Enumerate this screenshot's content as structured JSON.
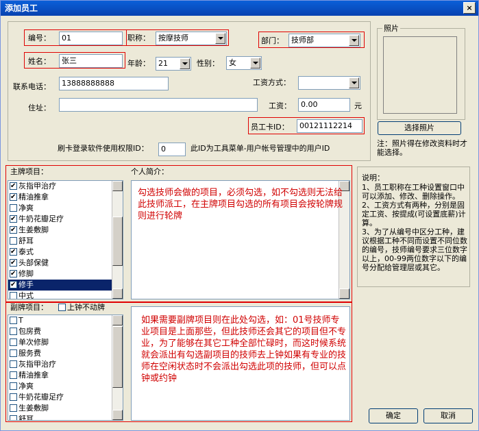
{
  "window": {
    "title": "添加员工",
    "close_label": "×"
  },
  "form": {
    "number_label": "编号：",
    "number_value": "01",
    "title_label": "职称：",
    "title_value": "按摩技师",
    "dept_label": "部门：",
    "dept_value": "技师部",
    "name_label": "姓名：",
    "name_value": "张三",
    "age_label": "年龄：",
    "age_value": "21",
    "gender_label": "性别：",
    "gender_value": "女",
    "phone_label": "联系电话：",
    "phone_value": "13888888888",
    "pay_label": "工资方式：",
    "pay_value": "",
    "address_label": "住址：",
    "address_value": "",
    "salary_label": "工资：",
    "salary_value": "0.00",
    "salary_unit": "元",
    "card_label": "员工卡ID：",
    "card_value": "00121112214",
    "perm_label": "刷卡登录软件使用权限ID：",
    "perm_value": "0",
    "perm_hint": "此ID为工具菜单-用户帐号管理中的用户ID"
  },
  "photo": {
    "label": "照片",
    "button": "选择照片",
    "note": "注：照片得在修改资料时才能选择。"
  },
  "main_items": {
    "label": "主牌项目：",
    "items": [
      {
        "text": "灰指甲治疗",
        "checked": true
      },
      {
        "text": "精油推拿",
        "checked": true
      },
      {
        "text": "净爽",
        "checked": false
      },
      {
        "text": "牛奶花瓣足疗",
        "checked": true
      },
      {
        "text": "生姜敷脚",
        "checked": true
      },
      {
        "text": "舒耳",
        "checked": false
      },
      {
        "text": "泰式",
        "checked": true
      },
      {
        "text": "头部保健",
        "checked": true
      },
      {
        "text": "修脚",
        "checked": true
      },
      {
        "text": "修手",
        "checked": true
      },
      {
        "text": "中式",
        "checked": false
      }
    ]
  },
  "bio": {
    "label": "个人简介：",
    "annotation": "勾选技师会做的项目，必须勾选，如不勾选则无法给此技师派工，在主牌项目勾选的所有项目会按轮牌规则进行轮牌"
  },
  "sub_items": {
    "label": "副牌项目：",
    "no_move_label": "上钟不动牌",
    "items": [
      {
        "text": "T",
        "checked": false
      },
      {
        "text": "包房费",
        "checked": false
      },
      {
        "text": "单次修脚",
        "checked": false
      },
      {
        "text": "服务费",
        "checked": false
      },
      {
        "text": "灰指甲治疗",
        "checked": false
      },
      {
        "text": "精油推拿",
        "checked": false
      },
      {
        "text": "净爽",
        "checked": false
      },
      {
        "text": "牛奶花瓣足疗",
        "checked": false
      },
      {
        "text": "生姜敷脚",
        "checked": false
      },
      {
        "text": "舒耳",
        "checked": false
      }
    ],
    "annotation": "如果需要副牌项目则在此处勾选，如：01号技师专业项目是上面那些，但此技师还会其它的项目但不专业，为了能够在其它工种全部忙碌时，而这时候系统就会派出有勾选副项目的技师去上钟如果有专业的技师在空闲状态时不会派出勾选此项的技师，但可以点钟或约钟"
  },
  "help": {
    "title": "说明：",
    "text": "1、员工职称在工种设置窗口中可以添加、修改、删除操作。\n2、工资方式有两种，分别是固定工资、按提成(可设置底薪)计算。\n3、为了从编号中区分工种，建议根据工种不同而设置不同位数的编号，技师编号要求三位数字以上，00-99两位数字以下的编号分配给管理层或其它。"
  },
  "buttons": {
    "ok": "确定",
    "cancel": "取消"
  }
}
